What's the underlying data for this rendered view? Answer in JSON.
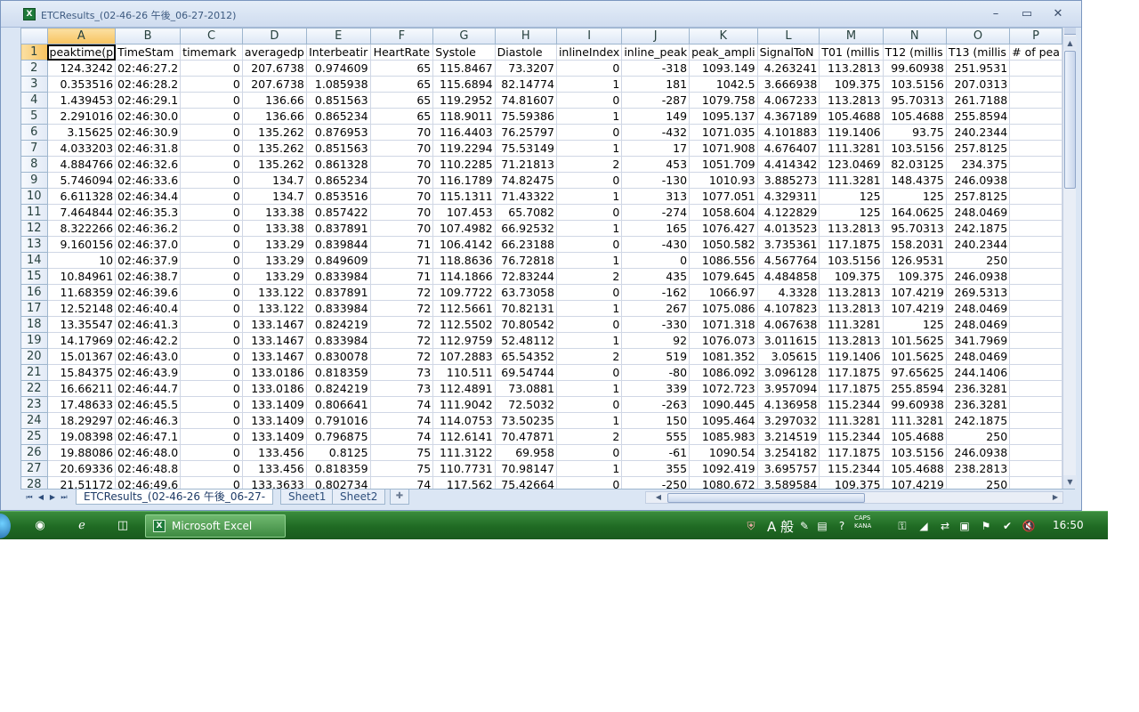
{
  "window": {
    "title": "ETCResults_(02-46-26 午後_06-27-2012)",
    "minimize": "–",
    "maximize": "▭",
    "close": "✕",
    "icon_letter": "X"
  },
  "sheet": {
    "column_letters": [
      "A",
      "B",
      "C",
      "D",
      "E",
      "F",
      "G",
      "H",
      "I",
      "J",
      "K",
      "L",
      "M",
      "N",
      "O",
      "P"
    ],
    "column_widths": [
      72,
      72,
      72,
      72,
      72,
      72,
      72,
      72,
      72,
      72,
      72,
      72,
      72,
      72,
      72,
      58
    ],
    "header_row": [
      "peaktime(p",
      "TimeStam",
      "timemark",
      "averagedp",
      "Interbeatir",
      "HeartRate",
      "Systole",
      "Diastole",
      "inlineIndex",
      "inline_peak",
      "peak_ampli",
      "SignalToN",
      "T01 (millis",
      "T12 (millis",
      "T13 (millis",
      "# of pea"
    ],
    "header_align": [
      "left",
      "left",
      "left",
      "center",
      "center",
      "center",
      "left",
      "left",
      "center",
      "left",
      "left",
      "left",
      "left",
      "left",
      "left",
      "left"
    ],
    "rows": [
      [
        "124.3242",
        "02:46:27.2",
        "0",
        "207.6738",
        "0.974609",
        "65",
        "115.8467",
        "73.3207",
        "0",
        "-318",
        "1093.149",
        "4.263241",
        "113.2813",
        "99.60938",
        "251.9531",
        ""
      ],
      [
        "0.353516",
        "02:46:28.2",
        "0",
        "207.6738",
        "1.085938",
        "65",
        "115.6894",
        "82.14774",
        "1",
        "181",
        "1042.5",
        "3.666938",
        "109.375",
        "103.5156",
        "207.0313",
        ""
      ],
      [
        "1.439453",
        "02:46:29.1",
        "0",
        "136.66",
        "0.851563",
        "65",
        "119.2952",
        "74.81607",
        "0",
        "-287",
        "1079.758",
        "4.067233",
        "113.2813",
        "95.70313",
        "261.7188",
        ""
      ],
      [
        "2.291016",
        "02:46:30.0",
        "0",
        "136.66",
        "0.865234",
        "65",
        "118.9011",
        "75.59386",
        "1",
        "149",
        "1095.137",
        "4.367189",
        "105.4688",
        "105.4688",
        "255.8594",
        ""
      ],
      [
        "3.15625",
        "02:46:30.9",
        "0",
        "135.262",
        "0.876953",
        "70",
        "116.4403",
        "76.25797",
        "0",
        "-432",
        "1071.035",
        "4.101883",
        "119.1406",
        "93.75",
        "240.2344",
        ""
      ],
      [
        "4.033203",
        "02:46:31.8",
        "0",
        "135.262",
        "0.851563",
        "70",
        "119.2294",
        "75.53149",
        "1",
        "17",
        "1071.908",
        "4.676407",
        "111.3281",
        "103.5156",
        "257.8125",
        ""
      ],
      [
        "4.884766",
        "02:46:32.6",
        "0",
        "135.262",
        "0.861328",
        "70",
        "110.2285",
        "71.21813",
        "2",
        "453",
        "1051.709",
        "4.414342",
        "123.0469",
        "82.03125",
        "234.375",
        ""
      ],
      [
        "5.746094",
        "02:46:33.6",
        "0",
        "134.7",
        "0.865234",
        "70",
        "116.1789",
        "74.82475",
        "0",
        "-130",
        "1010.93",
        "3.885273",
        "111.3281",
        "148.4375",
        "246.0938",
        ""
      ],
      [
        "6.611328",
        "02:46:34.4",
        "0",
        "134.7",
        "0.853516",
        "70",
        "115.1311",
        "71.43322",
        "1",
        "313",
        "1077.051",
        "4.329311",
        "125",
        "125",
        "257.8125",
        ""
      ],
      [
        "7.464844",
        "02:46:35.3",
        "0",
        "133.38",
        "0.857422",
        "70",
        "107.453",
        "65.7082",
        "0",
        "-274",
        "1058.604",
        "4.122829",
        "125",
        "164.0625",
        "248.0469",
        ""
      ],
      [
        "8.322266",
        "02:46:36.2",
        "0",
        "133.38",
        "0.837891",
        "70",
        "107.4982",
        "66.92532",
        "1",
        "165",
        "1076.427",
        "4.013523",
        "113.2813",
        "95.70313",
        "242.1875",
        ""
      ],
      [
        "9.160156",
        "02:46:37.0",
        "0",
        "133.29",
        "0.839844",
        "71",
        "106.4142",
        "66.23188",
        "0",
        "-430",
        "1050.582",
        "3.735361",
        "117.1875",
        "158.2031",
        "240.2344",
        ""
      ],
      [
        "10",
        "02:46:37.9",
        "0",
        "133.29",
        "0.849609",
        "71",
        "118.8636",
        "76.72818",
        "1",
        "0",
        "1086.556",
        "4.567764",
        "103.5156",
        "126.9531",
        "250",
        ""
      ],
      [
        "10.84961",
        "02:46:38.7",
        "0",
        "133.29",
        "0.833984",
        "71",
        "114.1866",
        "72.83244",
        "2",
        "435",
        "1079.645",
        "4.484858",
        "109.375",
        "109.375",
        "246.0938",
        ""
      ],
      [
        "11.68359",
        "02:46:39.6",
        "0",
        "133.122",
        "0.837891",
        "72",
        "109.7722",
        "63.73058",
        "0",
        "-162",
        "1066.97",
        "4.3328",
        "113.2813",
        "107.4219",
        "269.5313",
        ""
      ],
      [
        "12.52148",
        "02:46:40.4",
        "0",
        "133.122",
        "0.833984",
        "72",
        "112.5661",
        "70.82131",
        "1",
        "267",
        "1075.086",
        "4.107823",
        "113.2813",
        "107.4219",
        "248.0469",
        ""
      ],
      [
        "13.35547",
        "02:46:41.3",
        "0",
        "133.1467",
        "0.824219",
        "72",
        "112.5502",
        "70.80542",
        "0",
        "-330",
        "1071.318",
        "4.067638",
        "111.3281",
        "125",
        "248.0469",
        ""
      ],
      [
        "14.17969",
        "02:46:42.2",
        "0",
        "133.1467",
        "0.833984",
        "72",
        "112.9759",
        "52.48112",
        "1",
        "92",
        "1076.073",
        "3.011615",
        "113.2813",
        "101.5625",
        "341.7969",
        ""
      ],
      [
        "15.01367",
        "02:46:43.0",
        "0",
        "133.1467",
        "0.830078",
        "72",
        "107.2883",
        "65.54352",
        "2",
        "519",
        "1081.352",
        "3.05615",
        "119.1406",
        "101.5625",
        "248.0469",
        ""
      ],
      [
        "15.84375",
        "02:46:43.9",
        "0",
        "133.0186",
        "0.818359",
        "73",
        "110.511",
        "69.54744",
        "0",
        "-80",
        "1086.092",
        "3.096128",
        "117.1875",
        "97.65625",
        "244.1406",
        ""
      ],
      [
        "16.66211",
        "02:46:44.7",
        "0",
        "133.0186",
        "0.824219",
        "73",
        "112.4891",
        "73.0881",
        "1",
        "339",
        "1072.723",
        "3.957094",
        "117.1875",
        "255.8594",
        "236.3281",
        ""
      ],
      [
        "17.48633",
        "02:46:45.5",
        "0",
        "133.1409",
        "0.806641",
        "74",
        "111.9042",
        "72.5032",
        "0",
        "-263",
        "1090.445",
        "4.136958",
        "115.2344",
        "99.60938",
        "236.3281",
        ""
      ],
      [
        "18.29297",
        "02:46:46.3",
        "0",
        "133.1409",
        "0.791016",
        "74",
        "114.0753",
        "73.50235",
        "1",
        "150",
        "1095.464",
        "3.297032",
        "111.3281",
        "111.3281",
        "242.1875",
        ""
      ],
      [
        "19.08398",
        "02:46:47.1",
        "0",
        "133.1409",
        "0.796875",
        "74",
        "112.6141",
        "70.47871",
        "2",
        "555",
        "1085.983",
        "3.214519",
        "115.2344",
        "105.4688",
        "250",
        ""
      ],
      [
        "19.88086",
        "02:46:48.0",
        "0",
        "133.456",
        "0.8125",
        "75",
        "111.3122",
        "69.958",
        "0",
        "-61",
        "1090.54",
        "3.254182",
        "117.1875",
        "103.5156",
        "246.0938",
        ""
      ],
      [
        "20.69336",
        "02:46:48.8",
        "0",
        "133.456",
        "0.818359",
        "75",
        "110.7731",
        "70.98147",
        "1",
        "355",
        "1092.419",
        "3.695757",
        "115.2344",
        "105.4688",
        "238.2813",
        ""
      ],
      [
        "21.51172",
        "02:46:49.6",
        "0",
        "133.3633",
        "0.802734",
        "74",
        "117.562",
        "75.42664",
        "0",
        "-250",
        "1080.672",
        "3.589584",
        "109.375",
        "107.4219",
        "250",
        ""
      ]
    ]
  },
  "tabs": {
    "items": [
      "ETCResults_(02-46-26 午後_06-27-",
      "Sheet1",
      "Sheet2"
    ],
    "active_index": 0
  },
  "taskbar": {
    "excel_label": "Microsoft Excel",
    "ime": "A 般",
    "caps_top": "CAPS",
    "caps_bottom": "KANA",
    "clock": "16:50"
  },
  "colors": {
    "accent": "#1e7a3a",
    "taskbar": "#2a7a2e",
    "selection_header": "#f7c35f"
  }
}
